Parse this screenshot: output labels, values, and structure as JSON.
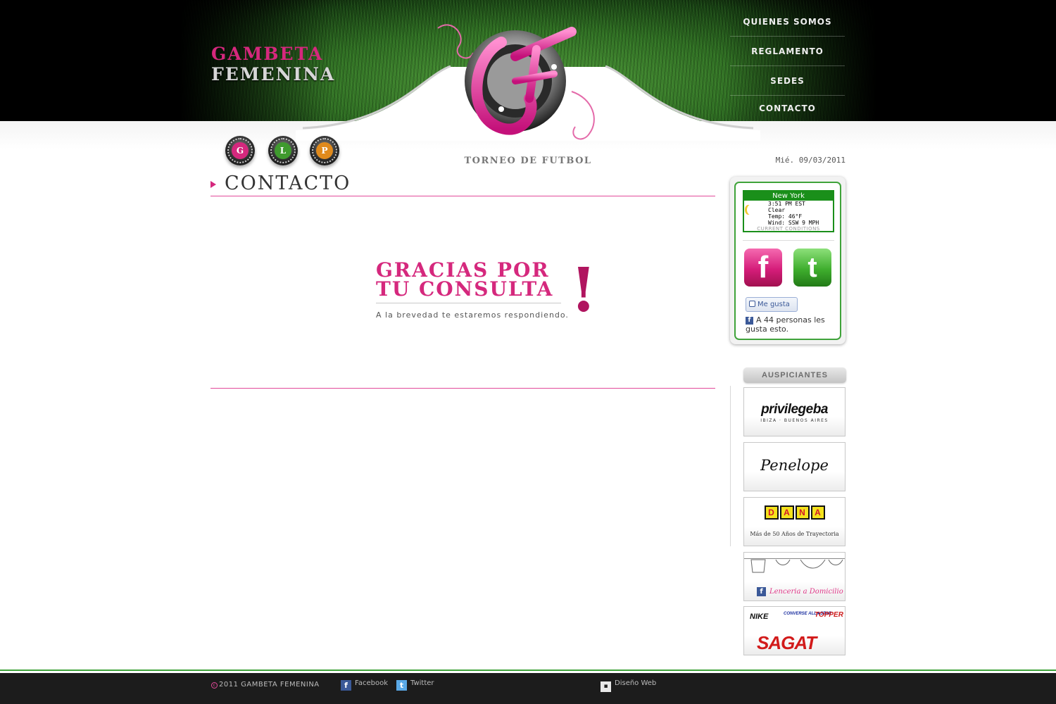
{
  "brand": {
    "line1": "GAMBETA",
    "line2": "FEMENINA"
  },
  "nav": [
    "QUIENES SOMOS",
    "REGLAMENTO",
    "SEDES",
    "CONTACTO"
  ],
  "tagline": "TORNEO DE FUTBOL",
  "date": "Mié. 09/03/2011",
  "round_buttons": [
    {
      "letter": "G",
      "color": "#d5287d"
    },
    {
      "letter": "L",
      "color": "#3f9a2e"
    },
    {
      "letter": "P",
      "color": "#e08a1c"
    }
  ],
  "section_title": "CONTACTO",
  "thanks": {
    "line1": "GRACIAS POR",
    "line2": "TU CONSULTA",
    "exclaim": "!",
    "sub": "A la brevedad te estaremos respondiendo."
  },
  "weather": {
    "city": "New York",
    "time": "3:51 PM EST",
    "cond": "Clear",
    "temp": "Temp: 46°F",
    "wind": "Wind: SSW 9 MPH",
    "footer": "CURRENT CONDITIONS"
  },
  "social": {
    "facebook_glyph": "f",
    "twitter_glyph": "t"
  },
  "like": {
    "label": "Me gusta",
    "count_text": "A 44 personas les gusta esto."
  },
  "sponsors_title": "AUSPICIANTES",
  "sponsors": {
    "s1": {
      "name": "privilegeba",
      "sub": "IBIZA · BUENOS AIRES"
    },
    "s2": {
      "name": "Penelope"
    },
    "s3": {
      "letters": [
        "D",
        "A",
        "N",
        "A"
      ],
      "sub": "Más de 50 Años de Trayectoria"
    },
    "s4": {
      "sub": "Lenceria a Domicilio"
    },
    "s5": {
      "a": "NIKE",
      "b": "CONVERSE ALL★STAR",
      "c": "TOPPER",
      "d": "SAGAT"
    }
  },
  "footer": {
    "copyright": "2011 GAMBETA FEMENINA",
    "facebook": "Facebook",
    "twitter": "Twitter",
    "design": "Diseño Web"
  },
  "colors": {
    "accent": "#d5287d",
    "green": "#3fa33a",
    "dark": "#1c1c1c"
  }
}
